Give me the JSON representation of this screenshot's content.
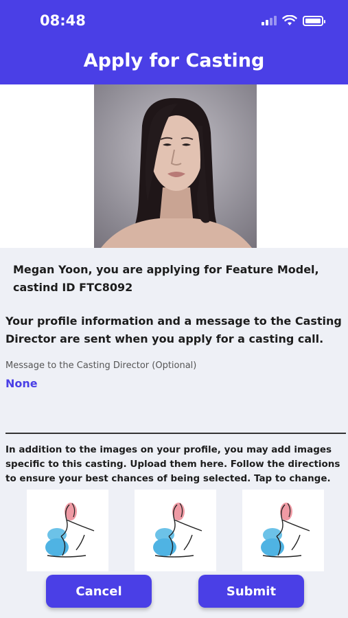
{
  "status_bar": {
    "time": "08:48",
    "icons": [
      "signal-icon",
      "wifi-icon",
      "battery-icon"
    ]
  },
  "header": {
    "title": "Apply for Casting"
  },
  "profile_photo": {
    "icon": "profile-photo"
  },
  "apply_line": "Megan Yoon, you are applying for Feature Model, castind ID FTC8092",
  "info_text": "Your profile information and a message to the Casting Director are sent when you apply for a casting call.",
  "message": {
    "label": "Message to the Casting Director (Optional)",
    "value": "None"
  },
  "upload_text": "In addition to the images on your profile, you may add images specific to this casting. Upload them here. Follow the directions to ensure your best chances of being selected. Tap to change.",
  "images": [
    {
      "icon": "pose-sketch-image"
    },
    {
      "icon": "pose-sketch-image"
    },
    {
      "icon": "pose-sketch-image"
    }
  ],
  "buttons": {
    "cancel": "Cancel",
    "submit": "Submit"
  },
  "colors": {
    "accent": "#4a3fe6",
    "background": "#eef0f6"
  }
}
